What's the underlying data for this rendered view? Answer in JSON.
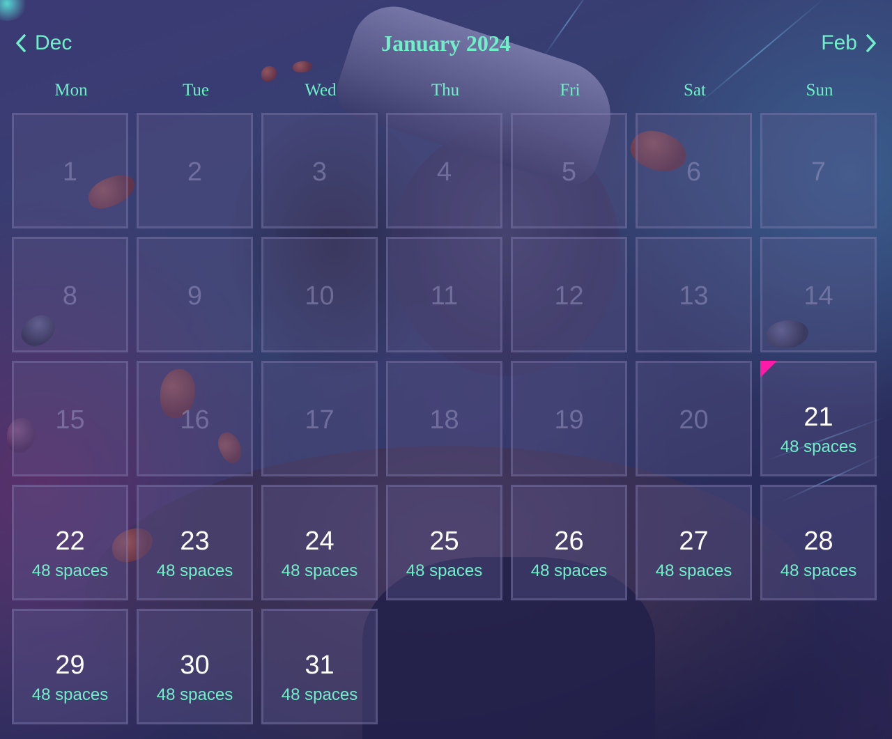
{
  "calendar": {
    "prev_label": "Dec",
    "next_label": "Feb",
    "title": "January 2024",
    "weekdays": [
      "Mon",
      "Tue",
      "Wed",
      "Thu",
      "Fri",
      "Sat",
      "Sun"
    ],
    "past_days": [
      "1",
      "2",
      "3",
      "4",
      "5",
      "6",
      "7",
      "8",
      "9",
      "10",
      "11",
      "12",
      "13",
      "14",
      "15",
      "16",
      "17",
      "18",
      "19",
      "20"
    ],
    "available_days": [
      {
        "day": "21",
        "spaces": "48 spaces",
        "today": true
      },
      {
        "day": "22",
        "spaces": "48 spaces"
      },
      {
        "day": "23",
        "spaces": "48 spaces"
      },
      {
        "day": "24",
        "spaces": "48 spaces"
      },
      {
        "day": "25",
        "spaces": "48 spaces"
      },
      {
        "day": "26",
        "spaces": "48 spaces"
      },
      {
        "day": "27",
        "spaces": "48 spaces"
      },
      {
        "day": "28",
        "spaces": "48 spaces"
      },
      {
        "day": "29",
        "spaces": "48 spaces"
      },
      {
        "day": "30",
        "spaces": "48 spaces"
      },
      {
        "day": "31",
        "spaces": "48 spaces"
      }
    ]
  },
  "colors": {
    "accent": "#6ff0c8",
    "today_marker": "#ff1aa8",
    "day_number_active": "#ffffff"
  },
  "icons": {
    "prev": "chevron-left-icon",
    "next": "chevron-right-icon"
  }
}
